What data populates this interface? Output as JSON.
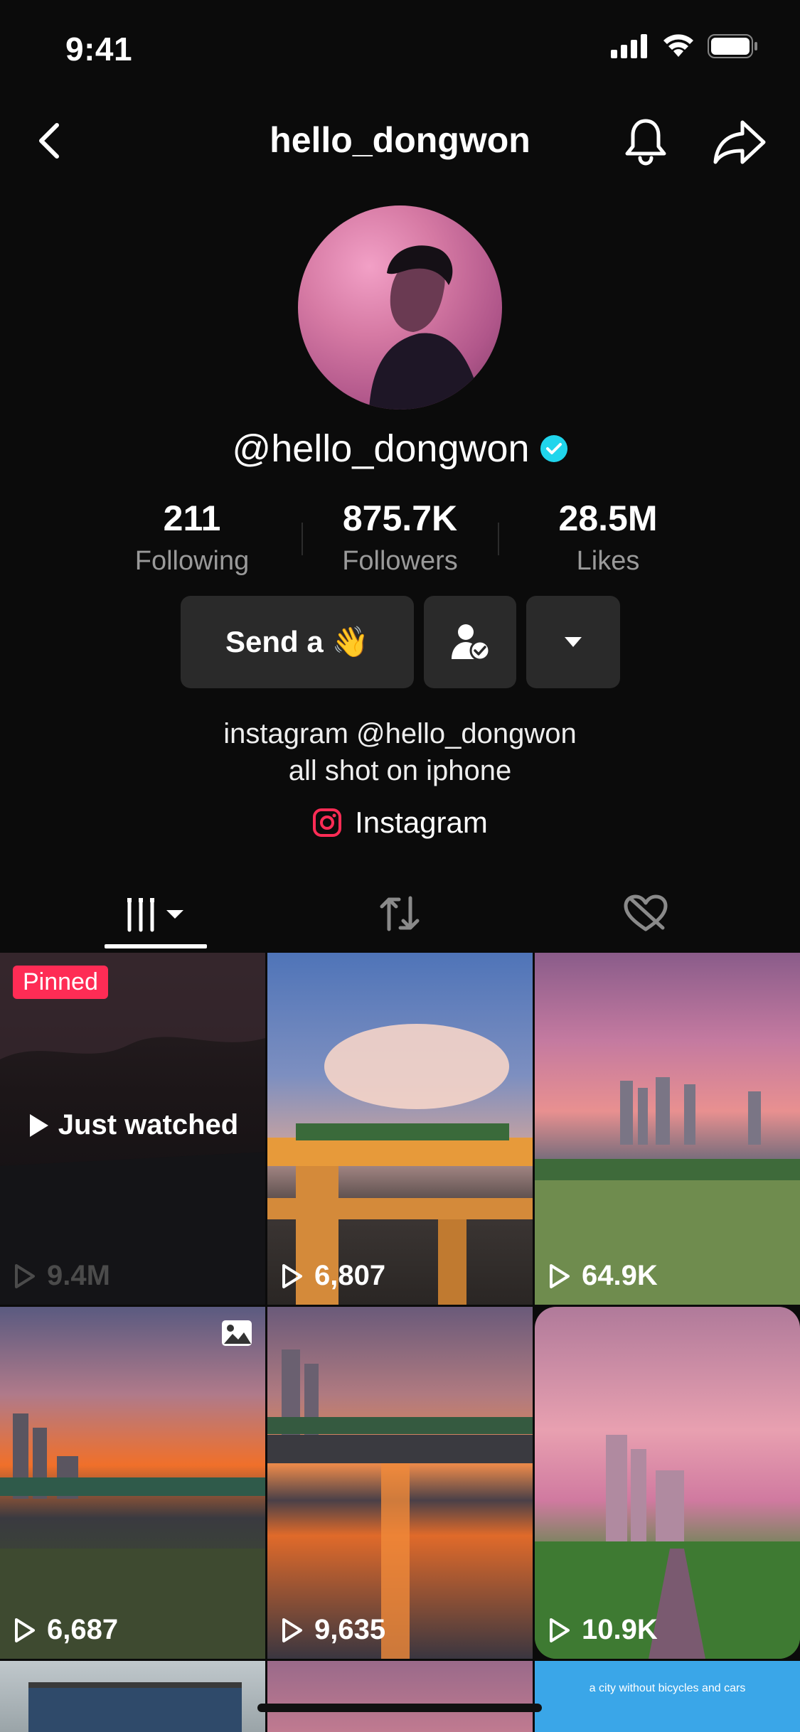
{
  "status_bar": {
    "time": "9:41"
  },
  "header": {
    "title": "hello_dongwon"
  },
  "profile": {
    "handle": "@hello_dongwon",
    "verified": true,
    "stats": [
      {
        "value": "211",
        "label": "Following"
      },
      {
        "value": "875.7K",
        "label": "Followers"
      },
      {
        "value": "28.5M",
        "label": "Likes"
      }
    ],
    "send_button": "Send a",
    "send_emoji": "👋",
    "bio_lines": [
      "instagram @hello_dongwon",
      "all shot on iphone"
    ],
    "link_label": "Instagram"
  },
  "tabs": [
    {
      "icon": "videos-grid-icon",
      "active": true
    },
    {
      "icon": "repost-icon",
      "active": false
    },
    {
      "icon": "liked-hidden-icon",
      "active": false
    }
  ],
  "videos": [
    {
      "views": "9.4M",
      "pinned_label": "Pinned",
      "overlay": "Just watched"
    },
    {
      "views": "6,807"
    },
    {
      "views": "64.9K"
    },
    {
      "views": "6,687",
      "photo": true
    },
    {
      "views": "9,635"
    },
    {
      "views": "10.9K"
    },
    {
      "views": ""
    },
    {
      "views": ""
    },
    {
      "views": "",
      "caption": "a city without bicycles and cars"
    }
  ],
  "colors": {
    "background": "#0b0b0b",
    "accent_pinned": "#fe2c55",
    "verified": "#20d5ec",
    "button_bg": "#2a2a2a"
  }
}
